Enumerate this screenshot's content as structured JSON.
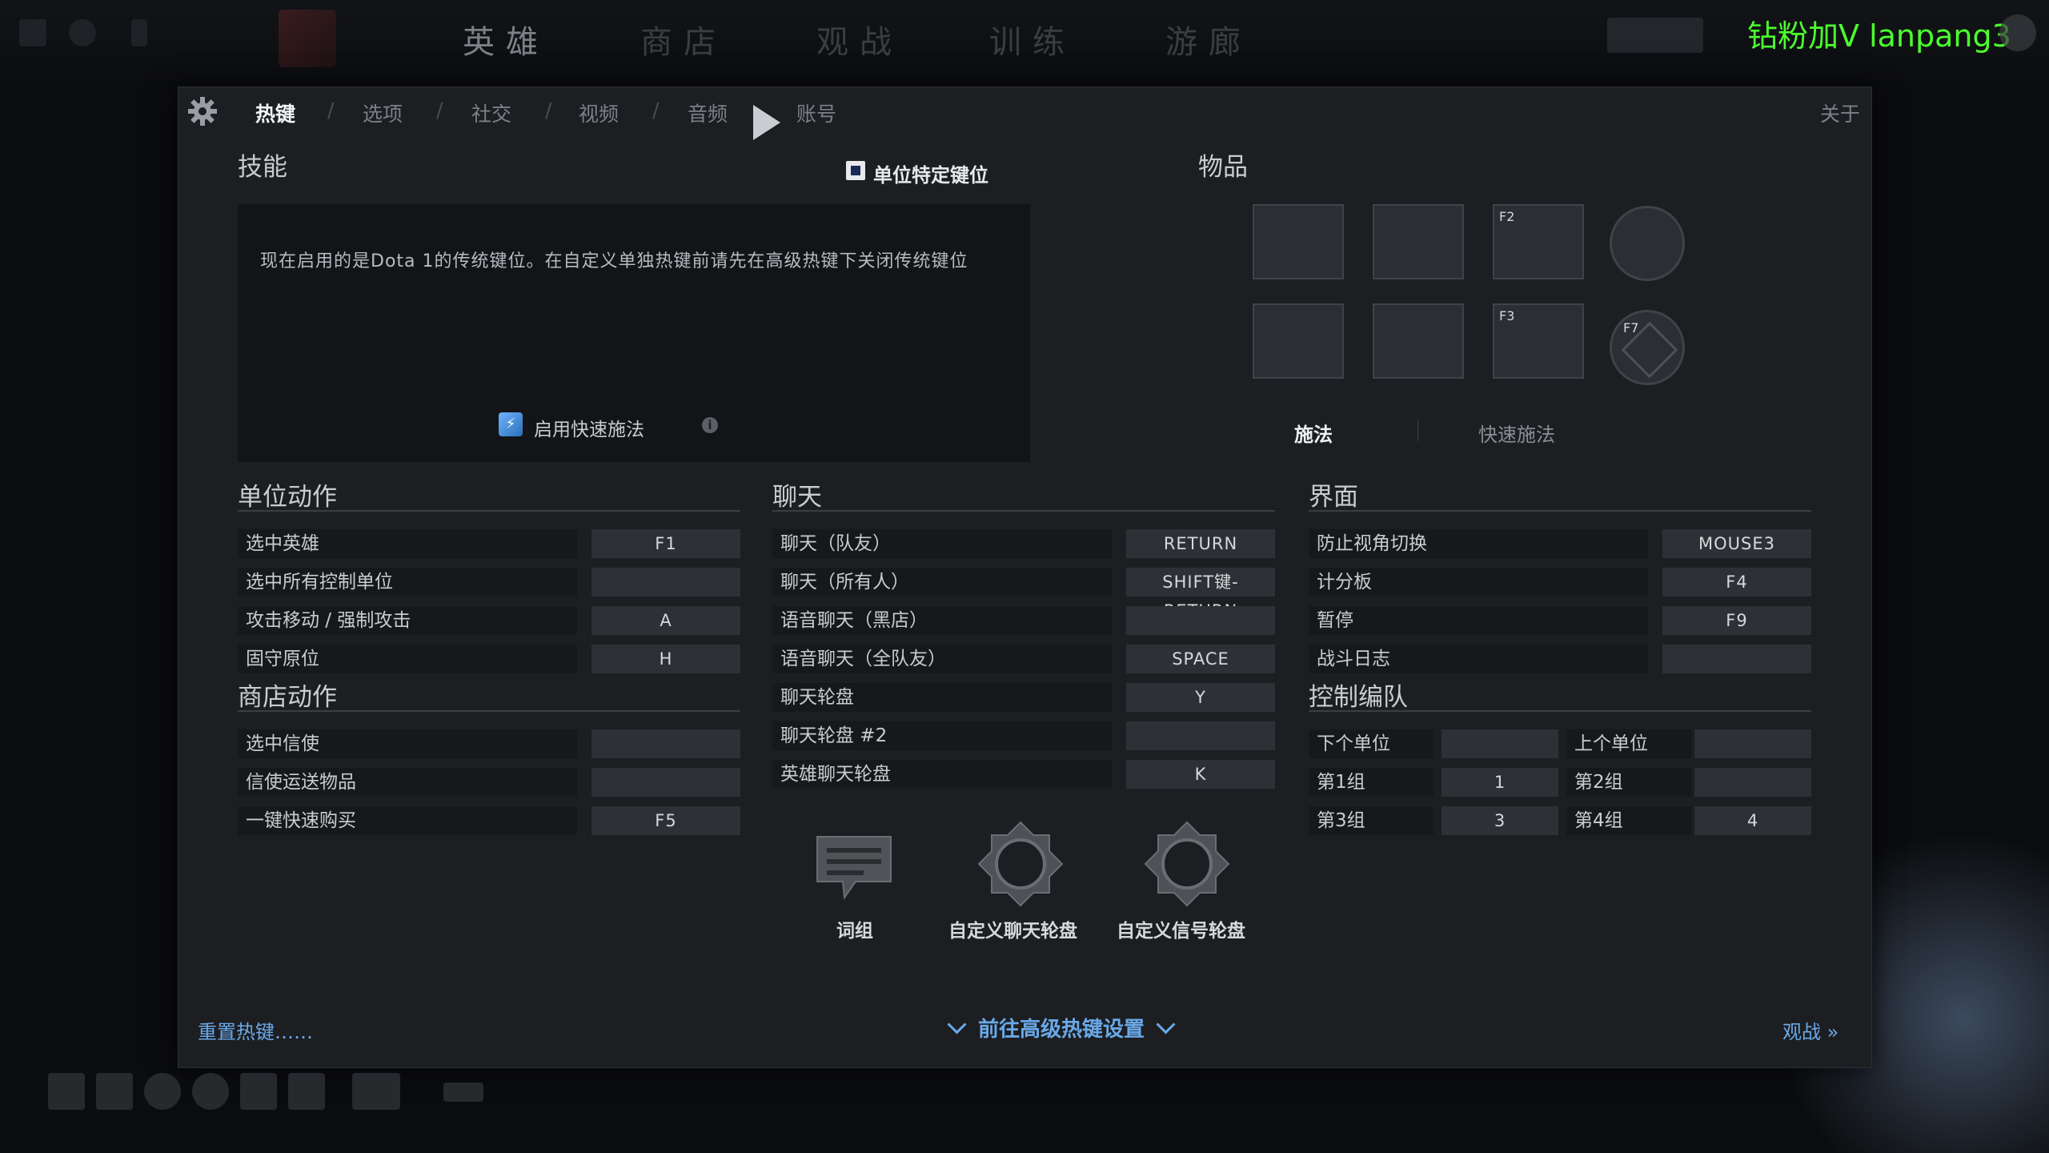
{
  "top": {
    "watermark": "钻粉加V lanpang3",
    "tabs": [
      "英雄",
      "商店",
      "观战",
      "训练",
      "游廊"
    ]
  },
  "nav": {
    "items": [
      "热键",
      "选项",
      "社交",
      "视频",
      "音频",
      "账号"
    ],
    "active": "热键",
    "separator": "/",
    "about": "关于"
  },
  "abilities": {
    "title": "技能",
    "unit_specific_checkbox": "单位特定键位",
    "notice": "现在启用的是Dota 1的传统键位。在自定义单独热键前请先在高级热键下关闭传统键位",
    "quickcast_label": "启用快速施法"
  },
  "items": {
    "title": "物品",
    "slot_keys": [
      "",
      "",
      "F2",
      "",
      "",
      "F3"
    ],
    "neutral_key": "F7",
    "cast_tabs": [
      "施法",
      "快速施法"
    ]
  },
  "unit_actions": {
    "title": "单位动作",
    "rows": [
      {
        "label": "选中英雄",
        "key": "F1"
      },
      {
        "label": "选中所有控制单位",
        "key": ""
      },
      {
        "label": "攻击移动 / 强制攻击",
        "key": "A"
      },
      {
        "label": "固守原位",
        "key": "H"
      }
    ]
  },
  "shop_actions": {
    "title": "商店动作",
    "rows": [
      {
        "label": "选中信使",
        "key": ""
      },
      {
        "label": "信使运送物品",
        "key": ""
      },
      {
        "label": "一键快速购买",
        "key": "F5"
      }
    ]
  },
  "chat": {
    "title": "聊天",
    "rows": [
      {
        "label": "聊天（队友）",
        "key": "RETURN"
      },
      {
        "label": "聊天（所有人）",
        "key": "SHIFT键-RETURN"
      },
      {
        "label": "语音聊天（黑店）",
        "key": ""
      },
      {
        "label": "语音聊天（全队友）",
        "key": "SPACE"
      },
      {
        "label": "聊天轮盘",
        "key": "Y"
      },
      {
        "label": "聊天轮盘 #2",
        "key": ""
      },
      {
        "label": "英雄聊天轮盘",
        "key": "K"
      }
    ],
    "wheels": [
      "词组",
      "自定义聊天轮盘",
      "自定义信号轮盘"
    ]
  },
  "interface": {
    "title": "界面",
    "rows": [
      {
        "label": "防止视角切换",
        "key": "MOUSE3"
      },
      {
        "label": "计分板",
        "key": "F4"
      },
      {
        "label": "暂停",
        "key": "F9"
      },
      {
        "label": "战斗日志",
        "key": ""
      }
    ]
  },
  "control_groups": {
    "title": "控制编队",
    "rows": [
      {
        "l1": "下个单位",
        "k1": "",
        "l2": "上个单位",
        "k2": ""
      },
      {
        "l1": "第1组",
        "k1": "1",
        "l2": "第2组",
        "k2": ""
      },
      {
        "l1": "第3组",
        "k1": "3",
        "l2": "第4组",
        "k2": "4"
      }
    ]
  },
  "footer": {
    "reset": "重置热键……",
    "advanced": "前往高级热键设置",
    "spectate": "观战 »"
  }
}
